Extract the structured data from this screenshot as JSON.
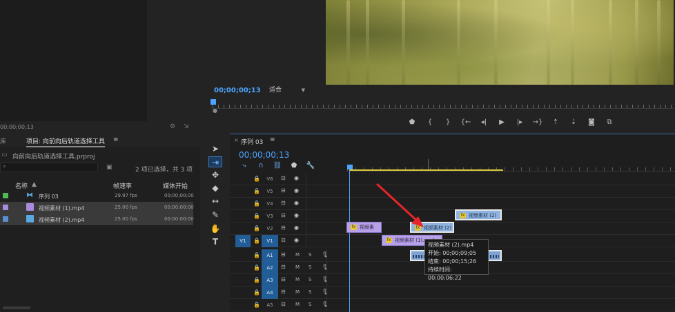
{
  "source_monitor": {
    "timecode": "00;00;00;13"
  },
  "program_monitor": {
    "timecode": "00;00;00;13",
    "fit_label": "适合"
  },
  "transport": {
    "buttons": [
      "marker-icon",
      "in-point-icon",
      "out-point-icon",
      "goto-in-icon",
      "step-back-icon",
      "play-icon",
      "step-forward-icon",
      "goto-out-icon",
      "lift-icon",
      "extract-icon",
      "export-frame-icon",
      "compare-icon"
    ]
  },
  "project_panel": {
    "prev_tab": "库",
    "active_tab": "项目: 向前向后轨道选择工具",
    "file_name": "向前向后轨道选择工具.prproj",
    "selection_count": "2 项已选择，共 3 项",
    "columns": {
      "name": "名称",
      "fps": "帧速率",
      "start": "媒体开始"
    },
    "rows": [
      {
        "swatch": "#4cbb57",
        "icon_color": "#5aa8e0",
        "name": "序列 03",
        "fps": "29.97 fps",
        "start": "00;00;00;00"
      },
      {
        "swatch": "#a88bdc",
        "icon_color": "#a88bdc",
        "name": "视频素材 (1).mp4",
        "fps": "25.00 fps",
        "start": "00:00:00:00"
      },
      {
        "swatch": "#5a8fd0",
        "icon_color": "#5aa8e0",
        "name": "视频素材 (2).mp4",
        "fps": "25.00 fps",
        "start": "00:00:00:00"
      }
    ]
  },
  "timeline": {
    "tab_label": "序列 03",
    "timecode": "00;00;00;13",
    "tracks": [
      {
        "name": "V6",
        "kind": "video"
      },
      {
        "name": "V5",
        "kind": "video"
      },
      {
        "name": "V4",
        "kind": "video"
      },
      {
        "name": "V3",
        "kind": "video"
      },
      {
        "name": "V2",
        "kind": "video"
      },
      {
        "name": "V1",
        "kind": "video"
      },
      {
        "name": "A1",
        "kind": "audio"
      },
      {
        "name": "A2",
        "kind": "audio"
      },
      {
        "name": "A3",
        "kind": "audio"
      },
      {
        "name": "A4",
        "kind": "audio"
      },
      {
        "name": "A5",
        "kind": "audio"
      }
    ],
    "source_patch": "V1",
    "mute_label": "M",
    "solo_label": "S",
    "clips": {
      "v3": "视频素材 (2)",
      "v2a": "视频素",
      "v2b": "视频素材 (2)",
      "v1": "视频素材 (1).mp4"
    },
    "tooltip": {
      "title": "视频素材 (2).mp4",
      "start": "开始: 00;00;09;05",
      "end": "结束: 00;00;15;26",
      "duration": "持续时间: 00;00;06;22"
    }
  },
  "colors": {
    "accent": "#4ea3ff",
    "clip_purple": "#b7a1e8",
    "clip_blue": "#8fb3e0",
    "track_on": "#225d97"
  }
}
